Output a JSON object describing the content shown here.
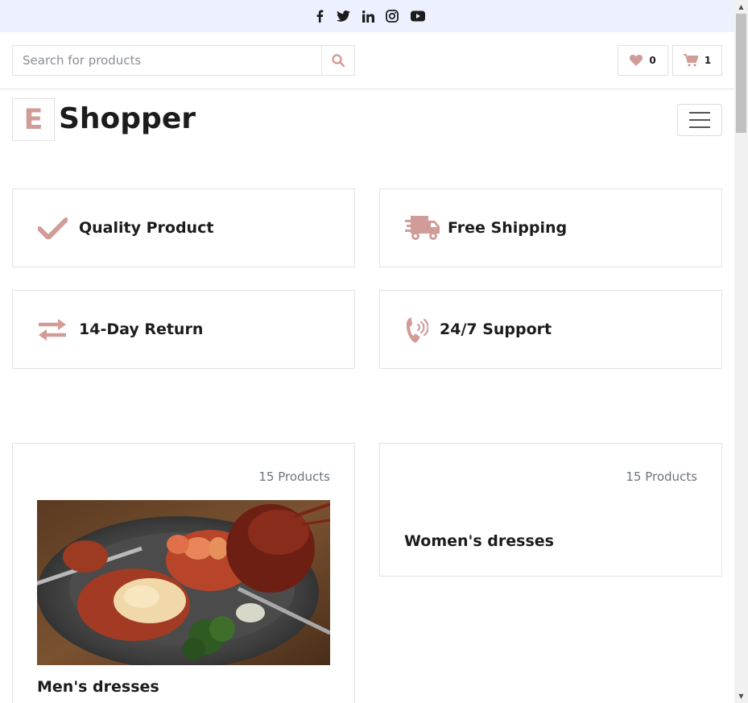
{
  "topbar": {
    "social_icons": [
      "facebook-icon",
      "twitter-icon",
      "linkedin-icon",
      "instagram-icon",
      "youtube-icon"
    ]
  },
  "search": {
    "placeholder": "Search for products",
    "icon": "search-icon"
  },
  "header_buttons": {
    "wishlist_count": "0",
    "cart_count": "1"
  },
  "brand": {
    "letter": "E",
    "name": "Shopper"
  },
  "features": [
    {
      "icon": "check-icon",
      "label": "Quality Product"
    },
    {
      "icon": "shipping-truck-icon",
      "label": "Free Shipping"
    },
    {
      "icon": "exchange-arrows-icon",
      "label": "14-Day Return"
    },
    {
      "icon": "phone-volume-icon",
      "label": "24/7 Support"
    }
  ],
  "categories": [
    {
      "count": "15 Products",
      "name": "Men's dresses",
      "image": "lobster-dish-photo"
    },
    {
      "count": "15 Products",
      "name": "Women's dresses"
    }
  ],
  "colors": {
    "accent": "#D19C97",
    "topbar_bg": "#EDF1FF",
    "text_dark": "#1C1C1C",
    "border": "#E3E3E3"
  }
}
